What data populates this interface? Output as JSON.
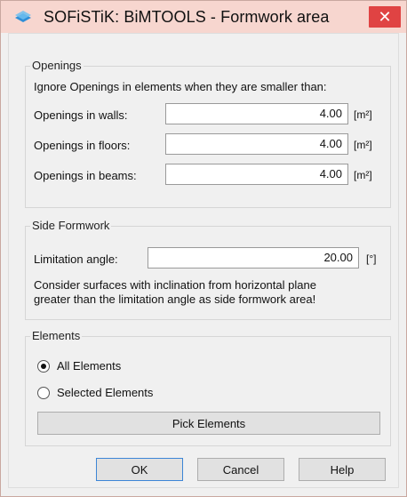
{
  "window": {
    "title": "SOFiSTiK: BiMTOOLS - Formwork area",
    "close_glyph": "✕",
    "app_icon": "sofistik-app-icon",
    "title_bar_color": "#f7d6cf",
    "close_color": "#e04343"
  },
  "openings": {
    "group_label": "Openings",
    "instruction": "Ignore Openings in elements when they are smaller than:",
    "rows": [
      {
        "label": "Openings in walls:",
        "value": "4.00",
        "unit": "[m²]"
      },
      {
        "label": "Openings in floors:",
        "value": "4.00",
        "unit": "[m²]"
      },
      {
        "label": "Openings in beams:",
        "value": "4.00",
        "unit": "[m²]"
      }
    ]
  },
  "side_formwork": {
    "group_label": "Side Formwork",
    "limitation_label": "Limitation angle:",
    "limitation_value": "20.00",
    "limitation_unit": "[°]",
    "description_line1": "Consider surfaces with inclination from horizontal plane",
    "description_line2": "greater than the limitation angle as side formwork area!"
  },
  "elements": {
    "group_label": "Elements",
    "options": [
      {
        "label": "All Elements",
        "selected": true
      },
      {
        "label": "Selected Elements",
        "selected": false
      }
    ],
    "pick_button": "Pick Elements"
  },
  "buttons": {
    "ok": "OK",
    "cancel": "Cancel",
    "help": "Help"
  }
}
